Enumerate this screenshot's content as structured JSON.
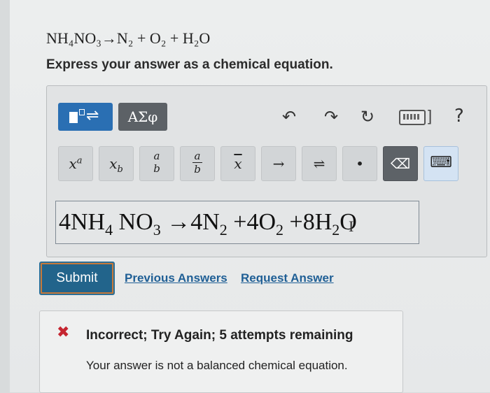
{
  "question": {
    "equation": "NH₄NO₃→N₂ + O₂ + H₂O",
    "instruction": "Express your answer as a chemical equation."
  },
  "toolbar": {
    "templates_icon": "templates-icon",
    "greek_label": "ΑΣφ",
    "undo_icon": "undo-icon",
    "redo_icon": "redo-icon",
    "reset_icon": "reset-icon",
    "keyboard_icon": "keyboard-icon",
    "help_label": "?"
  },
  "keys": [
    {
      "name": "superscript",
      "label": "x",
      "sup": "a"
    },
    {
      "name": "subscript",
      "label": "x",
      "sub": "b"
    },
    {
      "name": "fraction",
      "num": "a",
      "den": "b"
    },
    {
      "name": "fraction-bar",
      "num": "a",
      "den": "b"
    },
    {
      "name": "overline",
      "label": "x"
    },
    {
      "name": "arrow",
      "label": "→"
    },
    {
      "name": "equilibrium",
      "label": "⇌"
    },
    {
      "name": "dot",
      "label": "•"
    },
    {
      "name": "backspace",
      "label": "⌫"
    },
    {
      "name": "keyboard-toggle",
      "label": "⌨"
    }
  ],
  "answer": {
    "text": "4NH4NO3→4N2+4O2+8H2O"
  },
  "actions": {
    "submit_label": "Submit",
    "previous_answers_label": "Previous Answers",
    "request_answer_label": "Request Answer"
  },
  "feedback": {
    "title": "Incorrect; Try Again; 5 attempts remaining",
    "message": "Your answer is not a balanced chemical equation.",
    "status_color": "#c52530"
  },
  "colors": {
    "accent": "#2a6fb3",
    "submit": "#22648b",
    "link": "#1f5f95"
  }
}
